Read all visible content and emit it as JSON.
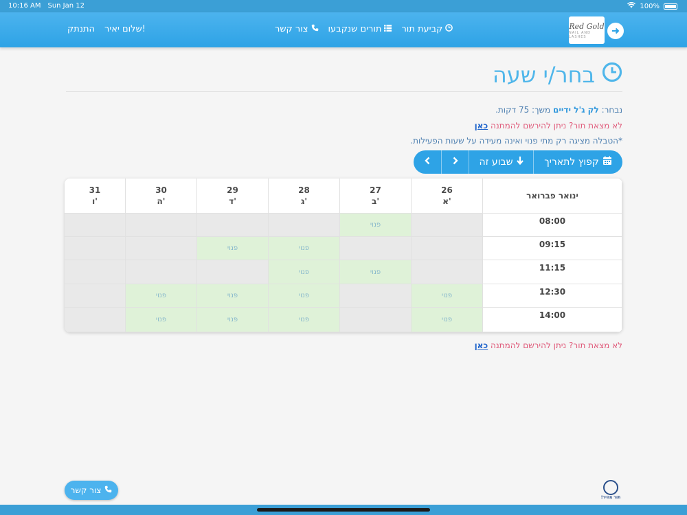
{
  "status_bar": {
    "time": "10:16 AM",
    "date": "Sun Jan 12",
    "battery": "100%"
  },
  "nav": {
    "logout": "התנתק",
    "greeting": "שלום יאיר!",
    "book": "קביעת תור",
    "booked": "תורים שנקבעו",
    "contact": "צור קשר",
    "logo_text": "Red Gold",
    "logo_sub": "NAIL AND LASHES"
  },
  "page": {
    "title": "בחר/י שעה",
    "selected_prefix": "נבחר: ",
    "selected_service": "לק ג'ל ידיים",
    "selected_suffix": " משך: 75 דקות.",
    "waitlist_text": "לא מצאת תור? ניתן להירשם להמתנה ",
    "waitlist_link": "כאן",
    "note": "*הטבלה מציגה רק מתי פנוי ואינה מעידה על שעות הפעילות."
  },
  "controls": {
    "jump": "קפוץ לתאריך",
    "this_week": "שבוע זה"
  },
  "table": {
    "month": "ינואר פברואר",
    "free_label": "פנוי",
    "days": [
      {
        "num": "26",
        "day": "א'"
      },
      {
        "num": "27",
        "day": "ב'"
      },
      {
        "num": "28",
        "day": "ג'"
      },
      {
        "num": "29",
        "day": "ד'"
      },
      {
        "num": "30",
        "day": "ה'"
      },
      {
        "num": "31",
        "day": "ו'"
      }
    ],
    "times": [
      "08:00",
      "09:15",
      "11:15",
      "12:30",
      "14:00"
    ],
    "slots": [
      [
        0,
        1,
        0,
        0,
        0,
        0
      ],
      [
        0,
        0,
        1,
        1,
        0,
        0
      ],
      [
        0,
        1,
        1,
        0,
        0,
        0
      ],
      [
        1,
        0,
        1,
        1,
        1,
        0
      ],
      [
        1,
        0,
        1,
        1,
        1,
        0
      ]
    ]
  },
  "footer": {
    "contact": "צור קשר",
    "brand": "תור מהיר!"
  },
  "colors": {
    "primary": "#2ea3e6",
    "title": "#4fb6ea",
    "free_slot": "#dff2d8",
    "busy_slot": "#e9e9e9",
    "waitlist": "#e05a7a"
  }
}
